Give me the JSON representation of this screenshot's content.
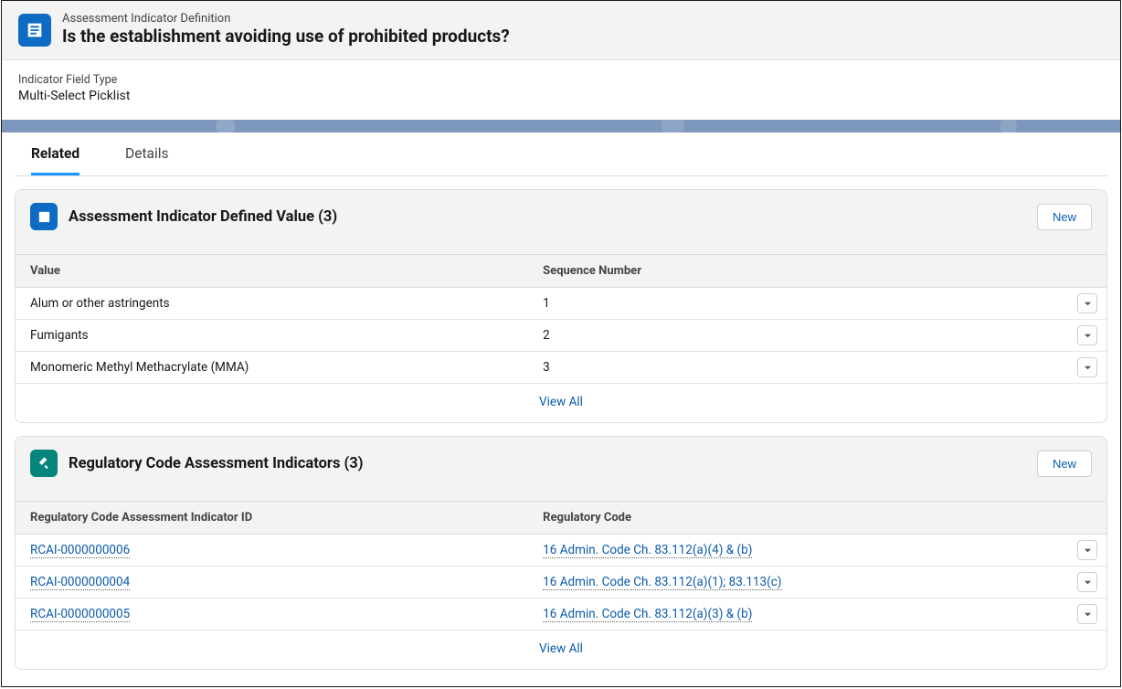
{
  "header": {
    "subtitle": "Assessment Indicator Definition",
    "title": "Is the establishment avoiding use of prohibited products?"
  },
  "field": {
    "label": "Indicator Field Type",
    "value": "Multi-Select Picklist"
  },
  "tabs": {
    "related": "Related",
    "details": "Details"
  },
  "card1": {
    "title": "Assessment Indicator Defined Value (3)",
    "new_label": "New",
    "columns": {
      "value": "Value",
      "sequence": "Sequence Number"
    },
    "rows": [
      {
        "value": "Alum or other astringents",
        "seq": "1"
      },
      {
        "value": "Fumigants",
        "seq": "2"
      },
      {
        "value": "Monomeric Methyl Methacrylate (MMA)",
        "seq": "3"
      }
    ],
    "view_all": "View All"
  },
  "card2": {
    "title": "Regulatory Code Assessment Indicators (3)",
    "new_label": "New",
    "columns": {
      "id": "Regulatory Code Assessment Indicator ID",
      "code": "Regulatory Code"
    },
    "rows": [
      {
        "id": "RCAI-0000000006",
        "code": "16 Admin. Code Ch. 83.112(a)(4) & (b)"
      },
      {
        "id": "RCAI-0000000004",
        "code": "16 Admin. Code Ch. 83.112(a)(1); 83.113(c)"
      },
      {
        "id": "RCAI-0000000005",
        "code": "16 Admin. Code Ch. 83.112(a)(3) & (b)"
      }
    ],
    "view_all": "View All"
  }
}
